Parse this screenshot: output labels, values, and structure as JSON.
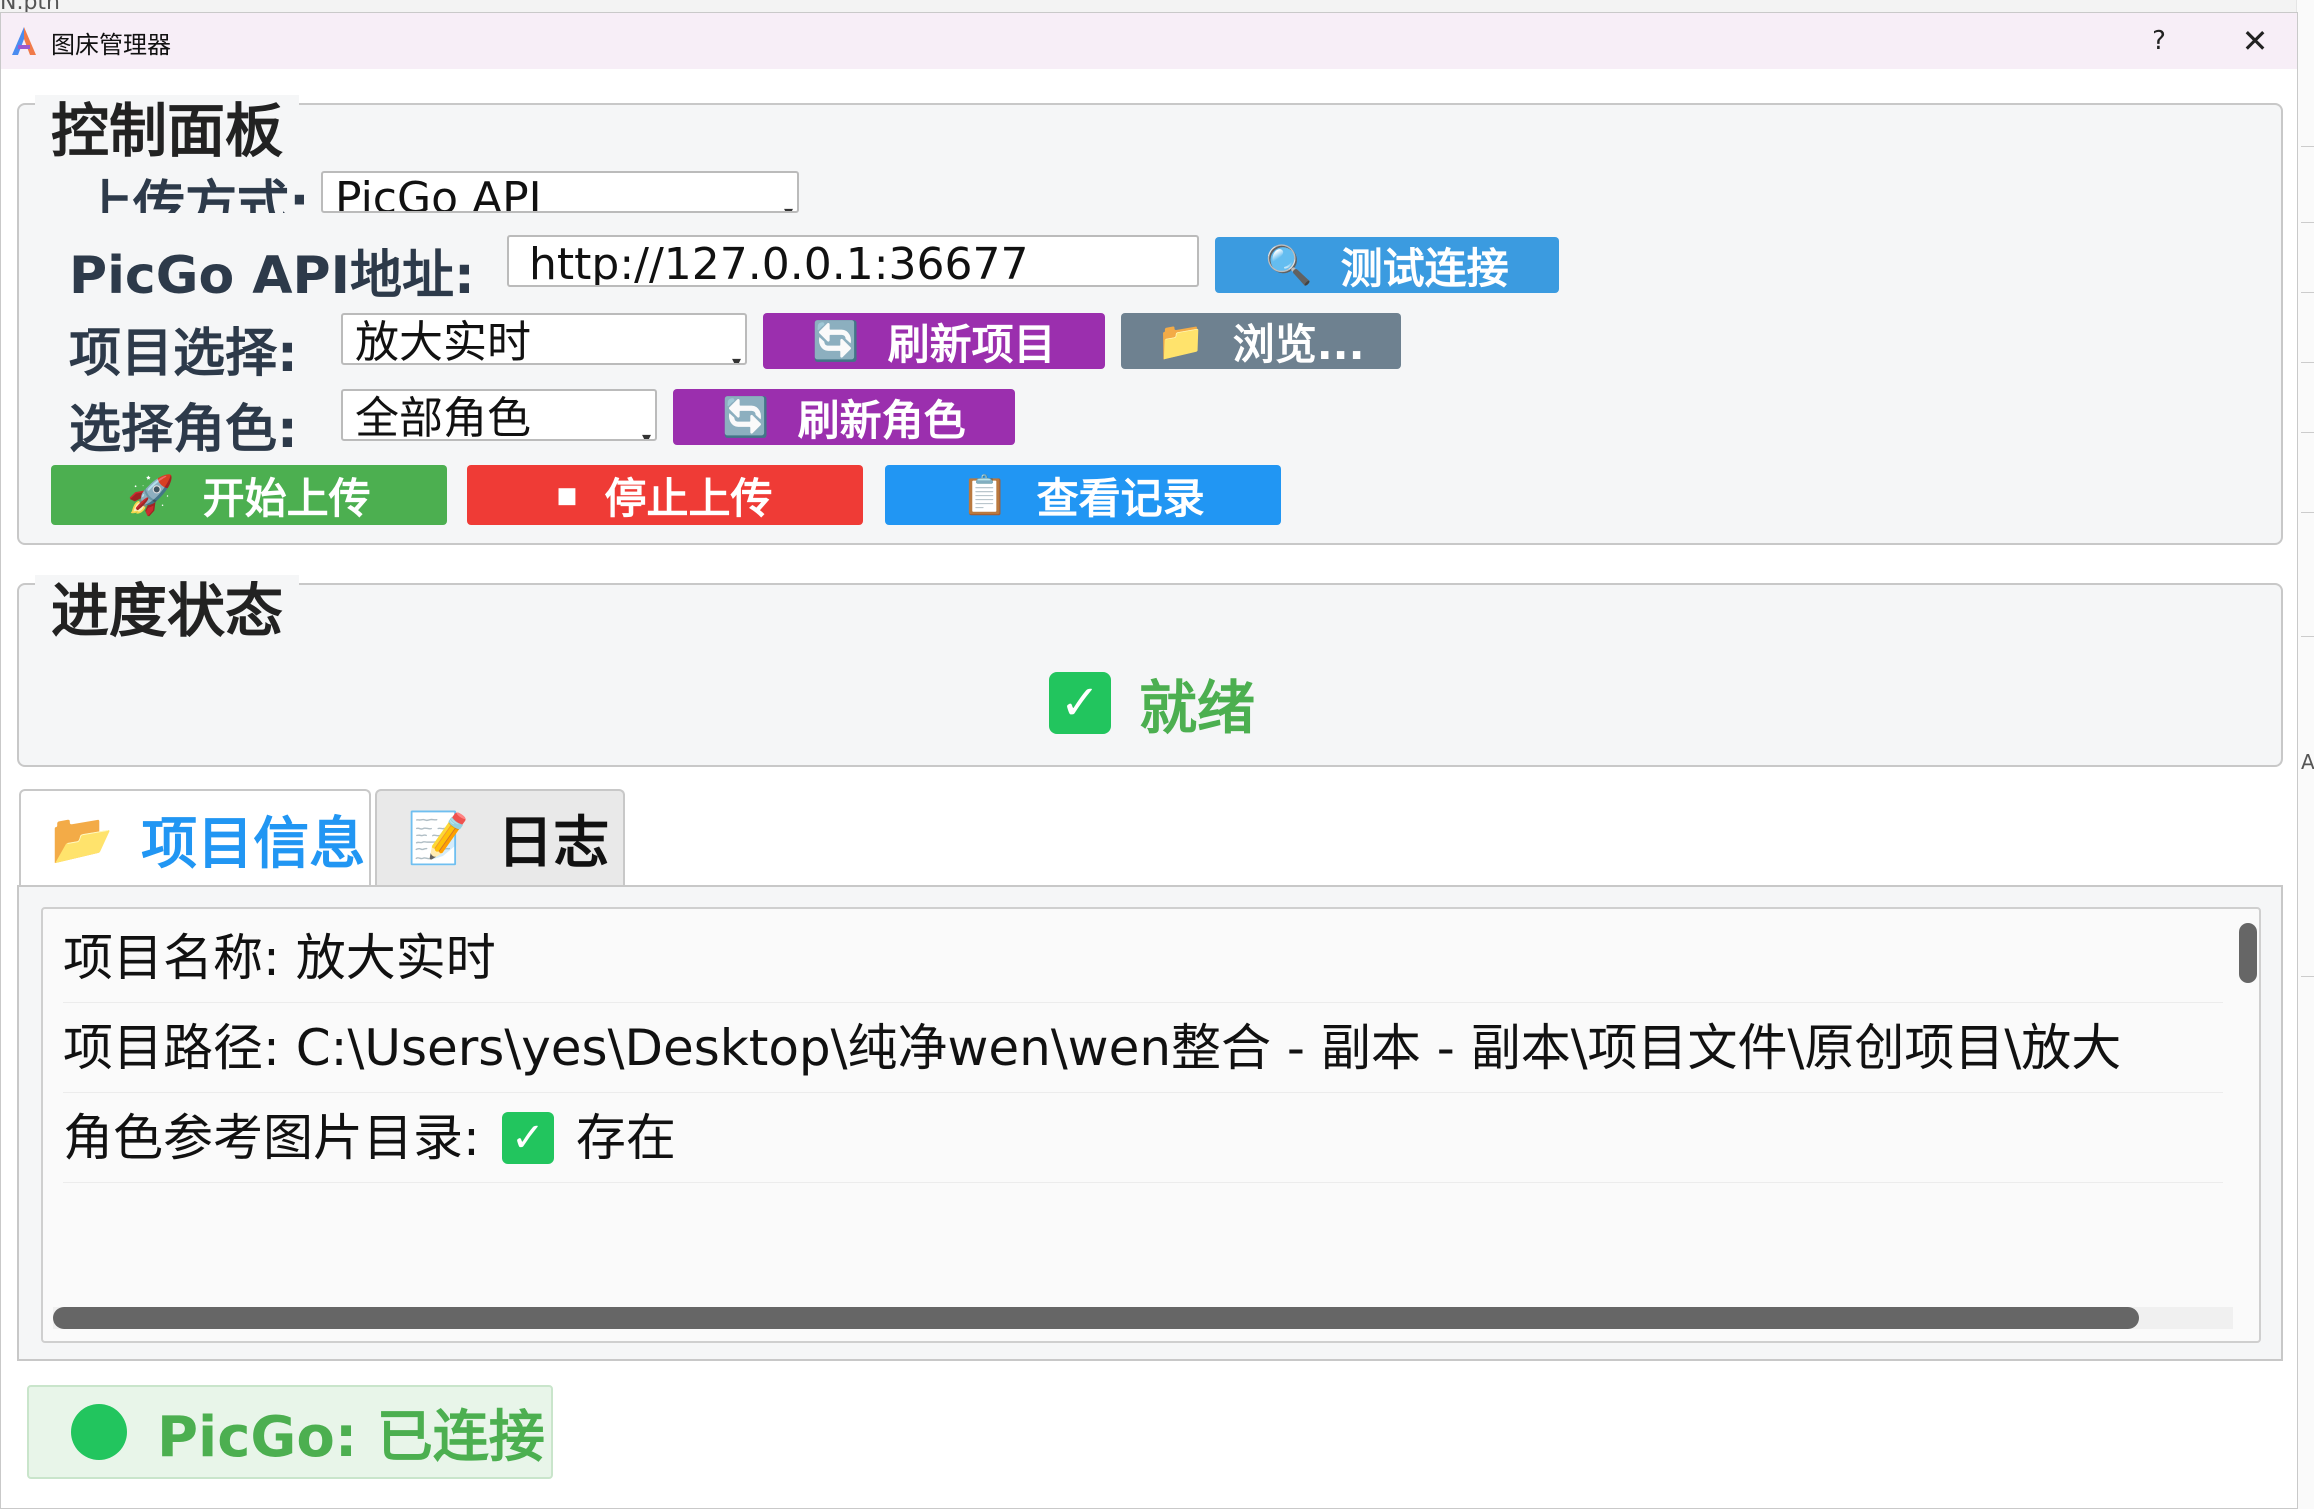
{
  "background": {
    "peek_text": "N.pth",
    "right_letter": "A"
  },
  "window": {
    "title": "图床管理器",
    "help": "?",
    "close": "✕"
  },
  "control_panel": {
    "title": "控制面板",
    "upload_method_label": "上传方式:",
    "upload_method_value": "PicGo API",
    "api_label": "PicGo API地址:",
    "api_value": "http://127.0.0.1:36677",
    "test_button": "测试连接",
    "project_label": "项目选择:",
    "project_value": "放大实时",
    "refresh_project_button": "刷新项目",
    "browse_button": "浏览...",
    "role_label": "选择角色:",
    "role_value": "全部角色",
    "refresh_role_button": "刷新角色",
    "start_button": "开始上传",
    "stop_button": "停止上传",
    "records_button": "查看记录"
  },
  "progress": {
    "title": "进度状态",
    "status": "就绪"
  },
  "tabs": [
    {
      "label": "项目信息",
      "icon": "folder-icon"
    },
    {
      "label": "日志",
      "icon": "memo-icon"
    }
  ],
  "info": {
    "name_row": "项目名称: 放大实时",
    "path_row": "项目路径: C:\\Users\\yes\\Desktop\\纯净wen\\wen整合 - 副本 - 副本\\项目文件\\原创项目\\放大",
    "role_dir_label": "角色参考图片目录:",
    "role_dir_status": "存在"
  },
  "connection": {
    "text": "PicGo: 已连接"
  },
  "colors": {
    "green": "#4caf50",
    "red": "#ef3b36",
    "blue": "#2196f3",
    "purple": "#9b2fae",
    "gray": "#6e8190",
    "connected": "#22c55e"
  }
}
